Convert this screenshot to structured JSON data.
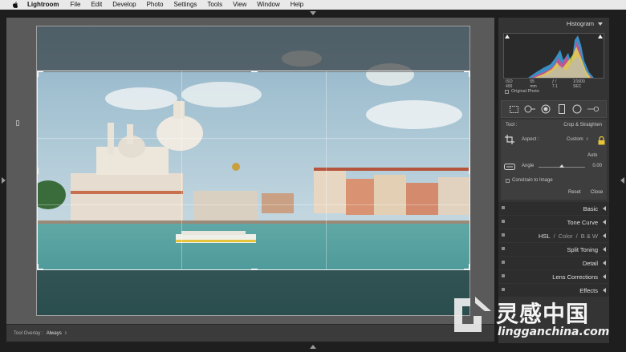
{
  "menubar": {
    "app": "Lightroom",
    "items": [
      "File",
      "Edit",
      "Develop",
      "Photo",
      "Settings",
      "Tools",
      "View",
      "Window",
      "Help"
    ]
  },
  "toolbar": {
    "overlay_label": "Tool Overlay :",
    "overlay_value": "Always"
  },
  "histogram": {
    "title": "Histogram",
    "iso": "ISO 400",
    "focal": "55 mm",
    "aperture": "ƒ / 7.1",
    "shutter": "1⁄1600 SEC",
    "original_photo": "Original Photo"
  },
  "crop": {
    "tool_label": "Tool :",
    "tool_value": "Crop & Straighten",
    "aspect_label": "Aspect :",
    "aspect_value": "Custom",
    "auto": "Auto",
    "angle_label": "Angle",
    "angle_value": "0.00",
    "angle": 0,
    "constrain": "Constrain to Image",
    "reset": "Reset",
    "close": "Close"
  },
  "sections": [
    {
      "label": "Basic"
    },
    {
      "label": "Tone Curve"
    },
    {
      "label": "HSL",
      "extra1": "Color",
      "extra2": "B & W"
    },
    {
      "label": "Split Toning"
    },
    {
      "label": "Detail"
    },
    {
      "label": "Lens Corrections"
    },
    {
      "label": "Effects"
    }
  ],
  "watermark": {
    "cn": "灵感中国",
    "url": "lingganchina.com"
  },
  "colors": {
    "accent": "#3b9bd6",
    "panel": "#343434",
    "section": "#2d2d2d"
  },
  "icons": [
    "apple-icon",
    "crop-overlay-icon",
    "spot-removal-icon",
    "red-eye-icon",
    "graduated-filter-icon",
    "radial-filter-icon",
    "adjustment-brush-icon",
    "lock-icon",
    "straighten-icon"
  ]
}
